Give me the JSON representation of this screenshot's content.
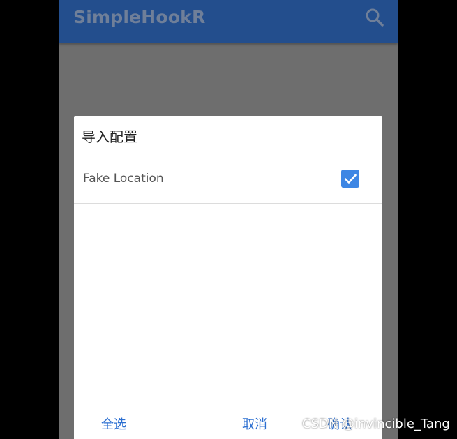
{
  "appbar": {
    "title": "SimpleHookR",
    "background": "#234e8d",
    "search_icon": "search-icon"
  },
  "dialog": {
    "title": "导入配置",
    "items": [
      {
        "label": "Fake Location",
        "checked": true
      }
    ],
    "buttons": {
      "select_all": "全选",
      "cancel": "取消",
      "confirm": "确认"
    },
    "accent": "#2c6fd1",
    "checkbox_color": "#3d86e4"
  },
  "watermark": "CSDN @invincible_Tang"
}
